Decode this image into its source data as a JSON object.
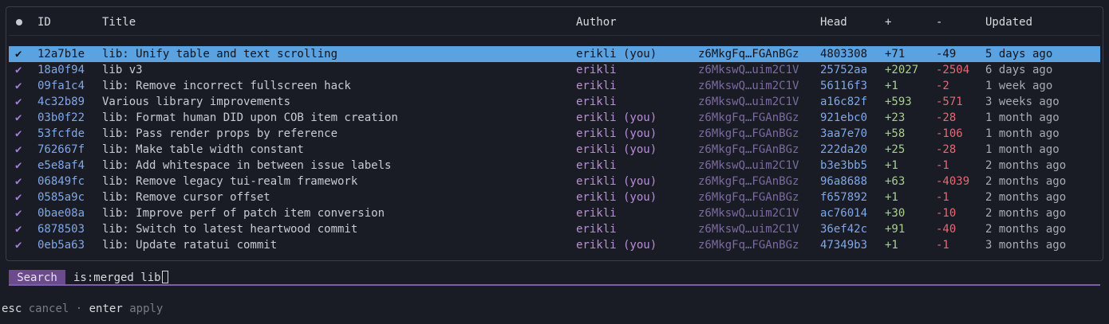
{
  "columns": {
    "id": "ID",
    "title": "Title",
    "author": "Author",
    "head": "Head",
    "plus": "+",
    "minus": "-",
    "updated": "Updated"
  },
  "rows": [
    {
      "state": "✔",
      "id": "12a7b1e",
      "title": "lib: Unify table and text scrolling",
      "author": "erikli (you)",
      "did": "z6MkgFq…FGAnBGz",
      "head": "4803308",
      "plus": "+71",
      "minus": "-49",
      "updated": "5 days ago",
      "selected": true
    },
    {
      "state": "✔",
      "id": "18a0f94",
      "title": "lib v3",
      "author": "erikli",
      "did": "z6MkswQ…uim2C1V",
      "head": "25752aa",
      "plus": "+2027",
      "minus": "-2504",
      "updated": "6 days ago"
    },
    {
      "state": "✔",
      "id": "09fa1c4",
      "title": "lib: Remove incorrect fullscreen hack",
      "author": "erikli",
      "did": "z6MkswQ…uim2C1V",
      "head": "56116f3",
      "plus": "+1",
      "minus": "-2",
      "updated": "1 week ago"
    },
    {
      "state": "✔",
      "id": "4c32b89",
      "title": "Various library improvements",
      "author": "erikli",
      "did": "z6MkswQ…uim2C1V",
      "head": "a16c82f",
      "plus": "+593",
      "minus": "-571",
      "updated": "3 weeks ago"
    },
    {
      "state": "✔",
      "id": "03b0f22",
      "title": "lib: Format human DID upon COB item creation",
      "author": "erikli (you)",
      "did": "z6MkgFq…FGAnBGz",
      "head": "921ebc0",
      "plus": "+23",
      "minus": "-28",
      "updated": "1 month ago"
    },
    {
      "state": "✔",
      "id": "53fcfde",
      "title": "lib: Pass render props by reference",
      "author": "erikli (you)",
      "did": "z6MkgFq…FGAnBGz",
      "head": "3aa7e70",
      "plus": "+58",
      "minus": "-106",
      "updated": "1 month ago"
    },
    {
      "state": "✔",
      "id": "762667f",
      "title": "lib: Make table width constant",
      "author": "erikli (you)",
      "did": "z6MkgFq…FGAnBGz",
      "head": "222da20",
      "plus": "+25",
      "minus": "-28",
      "updated": "1 month ago"
    },
    {
      "state": "✔",
      "id": "e5e8af4",
      "title": "lib: Add whitespace in between issue labels",
      "author": "erikli",
      "did": "z6MkswQ…uim2C1V",
      "head": "b3e3bb5",
      "plus": "+1",
      "minus": "-1",
      "updated": "2 months ago"
    },
    {
      "state": "✔",
      "id": "06849fc",
      "title": "lib: Remove legacy tui-realm framework",
      "author": "erikli (you)",
      "did": "z6MkgFq…FGAnBGz",
      "head": "96a8688",
      "plus": "+63",
      "minus": "-4039",
      "updated": "2 months ago"
    },
    {
      "state": "✔",
      "id": "0585a9c",
      "title": "lib: Remove cursor offset",
      "author": "erikli (you)",
      "did": "z6MkgFq…FGAnBGz",
      "head": "f657892",
      "plus": "+1",
      "minus": "-1",
      "updated": "2 months ago"
    },
    {
      "state": "✔",
      "id": "0bae08a",
      "title": "lib: Improve perf of patch item conversion",
      "author": "erikli",
      "did": "z6MkswQ…uim2C1V",
      "head": "ac76014",
      "plus": "+30",
      "minus": "-10",
      "updated": "2 months ago"
    },
    {
      "state": "✔",
      "id": "6878503",
      "title": "lib: Switch to latest heartwood commit",
      "author": "erikli",
      "did": "z6MkswQ…uim2C1V",
      "head": "36ef42c",
      "plus": "+91",
      "minus": "-40",
      "updated": "2 months ago"
    },
    {
      "state": "✔",
      "id": "0eb5a63",
      "title": "lib: Update ratatui commit",
      "author": "erikli (you)",
      "did": "z6MkgFq…FGAnBGz",
      "head": "47349b3",
      "plus": "+1",
      "minus": "-1",
      "updated": "3 months ago"
    }
  ],
  "search": {
    "label": "Search",
    "value": "is:merged lib"
  },
  "help": {
    "esc_key": "esc",
    "esc_action": "cancel",
    "separator": "·",
    "enter_key": "enter",
    "enter_action": "apply"
  }
}
